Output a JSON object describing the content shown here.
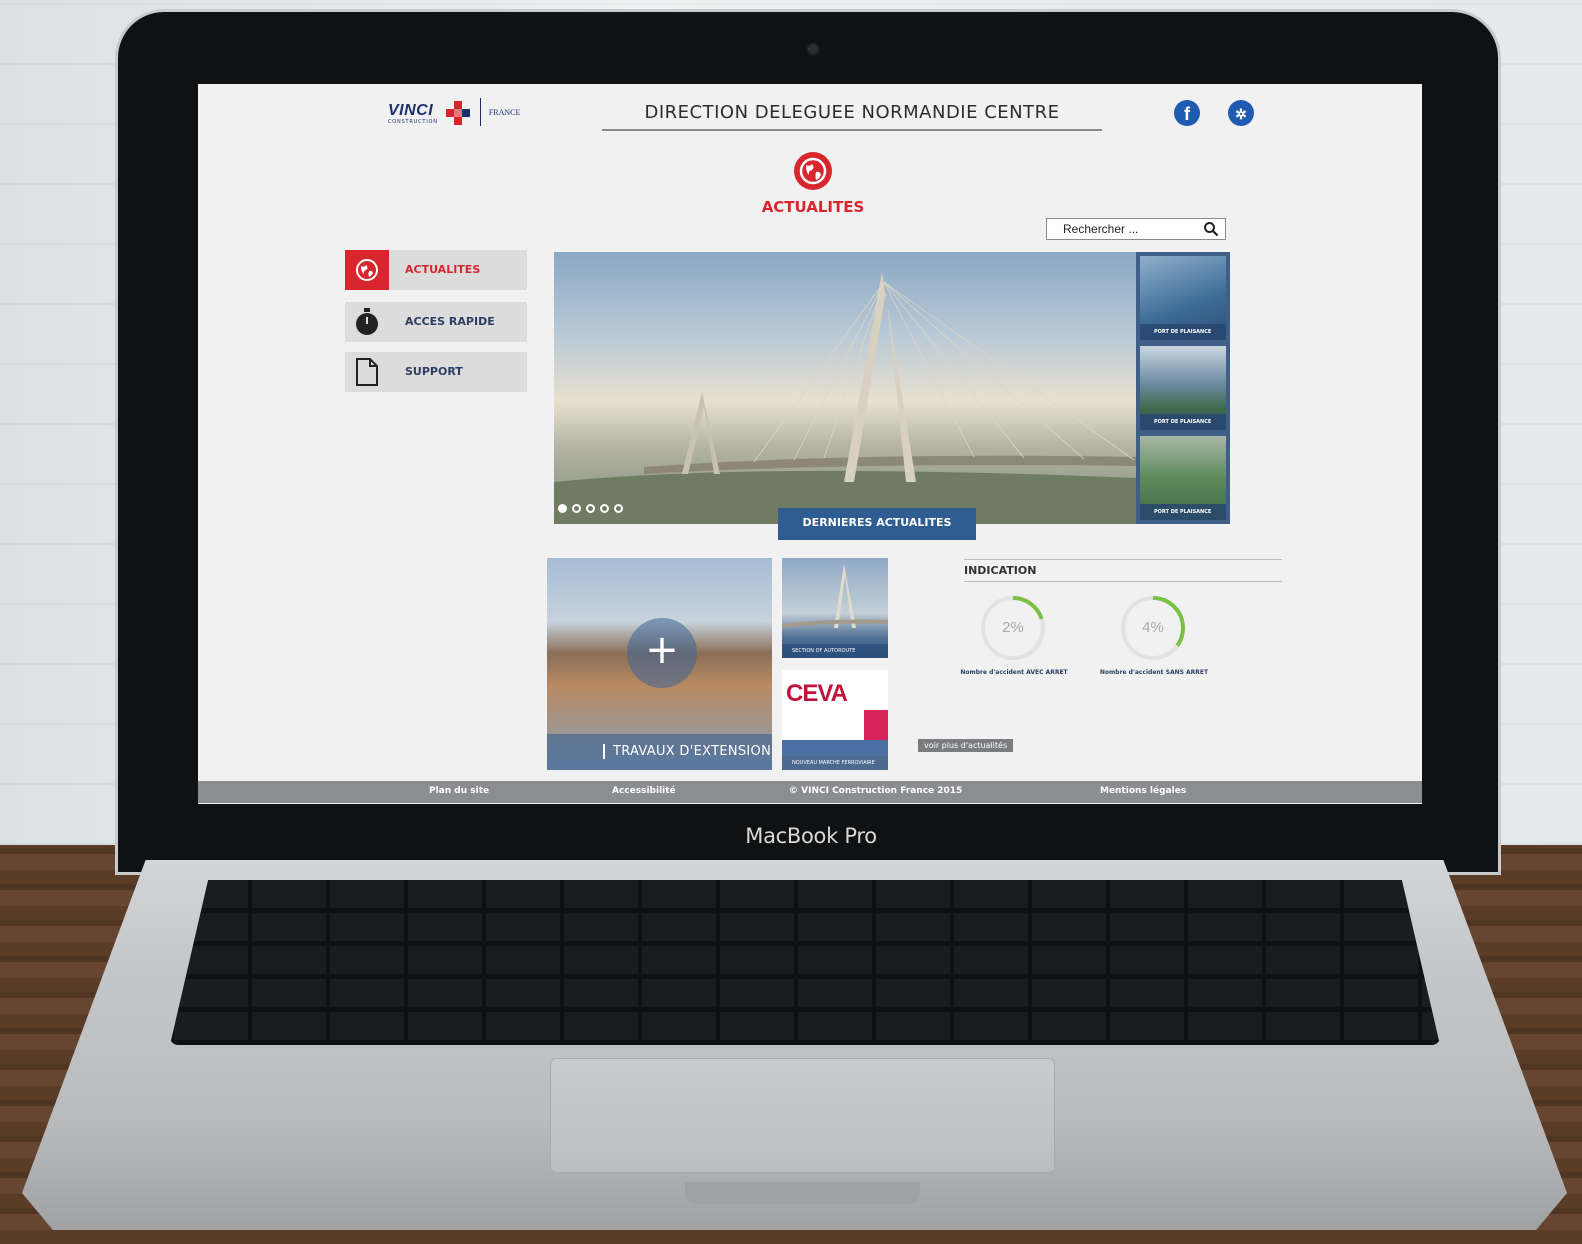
{
  "laptop": {
    "brand": "MacBook Pro"
  },
  "header": {
    "logo_text": "VINCI",
    "logo_sub": "CONSTRUCTION",
    "logo_region": "FRANCE",
    "title": "DIRECTION DELEGUEE NORMANDIE CENTRE",
    "social": [
      {
        "name": "facebook-icon",
        "glyph": "f"
      },
      {
        "name": "share-icon",
        "glyph": "✲"
      }
    ]
  },
  "section": {
    "title": "ACTUALITES"
  },
  "search": {
    "placeholder": "Rechercher ..."
  },
  "sidebar": {
    "items": [
      {
        "label": "ACTUALITES",
        "icon": "globe-icon",
        "active": true
      },
      {
        "label": "ACCES RAPIDE",
        "icon": "stopwatch-icon",
        "active": false
      },
      {
        "label": "SUPPORT",
        "icon": "document-icon",
        "active": false
      }
    ]
  },
  "carousel": {
    "caption": "DERNIERES ACTUALITES",
    "dots": 5,
    "active_dot": 0,
    "thumbnails": [
      {
        "caption": "PORT DE PLAISANCE"
      },
      {
        "caption": "PORT DE PLAISANCE"
      },
      {
        "caption": "PORT DE PLAISANCE"
      }
    ]
  },
  "tiles": {
    "big_caption": "TRAVAUX D'EXTENSION",
    "small1_caption": "SECTION OF AUTOROUTE",
    "small2_logo": "CEVA",
    "small2_caption": "NOUVEAU MARCHE FERROVIAIRE",
    "more_link": "voir plus d'actualités"
  },
  "indication": {
    "title": "INDICATION",
    "gauges": [
      {
        "value": "2%",
        "fraction": 0.2,
        "label": "Nombre d'accident AVEC ARRET"
      },
      {
        "value": "4%",
        "fraction": 0.35,
        "label": "Nombre d'accident SANS ARRET"
      }
    ]
  },
  "footer": {
    "links": [
      "Plan du site",
      "Accessibilité",
      "© VINCI Construction France 2015",
      "Mentions légales"
    ]
  },
  "colors": {
    "accent": "#d8262f",
    "navy": "#1e2f6e",
    "blue": "#2f5c91",
    "gauge": "#7ac143"
  }
}
